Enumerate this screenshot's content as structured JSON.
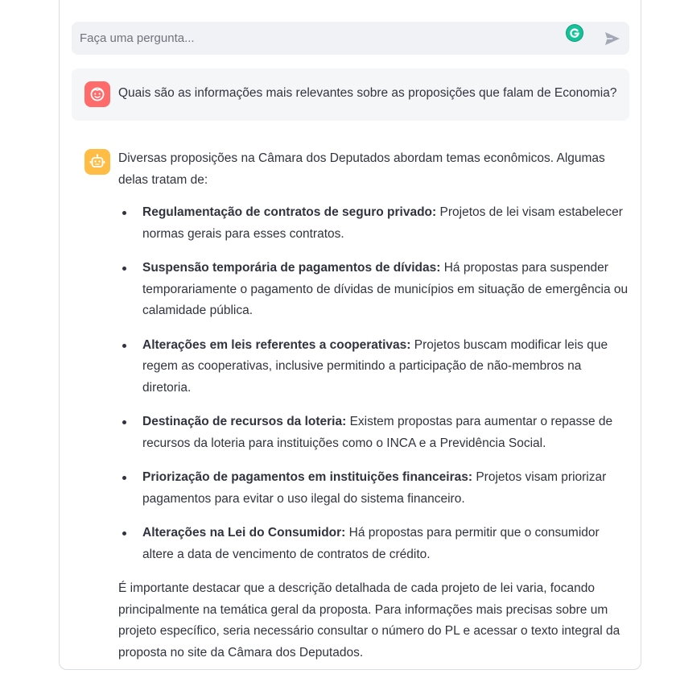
{
  "chat_input": {
    "placeholder": "Faça uma pergunta..."
  },
  "icons": {
    "grammarly": "grammarly-icon",
    "send": "send-arrow-icon",
    "user_avatar": "user-face-icon",
    "bot_avatar": "robot-icon"
  },
  "colors": {
    "user_avatar_bg": "#ff6b6b",
    "bot_avatar_bg": "#ffbd45",
    "input_bg": "#f0f2f6",
    "text": "#31333f"
  },
  "user_message": {
    "text": "Quais são as informações mais relevantes sobre as proposições que falam de Economia?"
  },
  "bot_message": {
    "intro": "Diversas proposições na Câmara dos Deputados abordam temas econômicos. Algumas delas tratam de:",
    "items": [
      {
        "title": "Regulamentação de contratos de seguro privado:",
        "text": " Projetos de lei visam estabelecer normas gerais para esses contratos."
      },
      {
        "title": "Suspensão temporária de pagamentos de dívidas:",
        "text": " Há propostas para suspender temporariamente o pagamento de dívidas de municípios em situação de emergência ou calamidade pública."
      },
      {
        "title": "Alterações em leis referentes a cooperativas:",
        "text": " Projetos buscam modificar leis que regem as cooperativas, inclusive permitindo a participação de não-membros na diretoria."
      },
      {
        "title": "Destinação de recursos da loteria:",
        "text": " Existem propostas para aumentar o repasse de recursos da loteria para instituições como o INCA e a Previdência Social."
      },
      {
        "title": "Priorização de pagamentos em instituições financeiras:",
        "text": " Projetos visam priorizar pagamentos para evitar o uso ilegal do sistema financeiro."
      },
      {
        "title": "Alterações na Lei do Consumidor:",
        "text": " Há propostas para permitir que o consumidor altere a data de vencimento de contratos de crédito."
      }
    ],
    "closing": "É importante destacar que a descrição detalhada de cada projeto de lei varia, focando principalmente na temática geral da proposta. Para informações mais precisas sobre um projeto específico, seria necessário consultar o número do PL e acessar o texto integral da proposta no site da Câmara dos Deputados."
  }
}
